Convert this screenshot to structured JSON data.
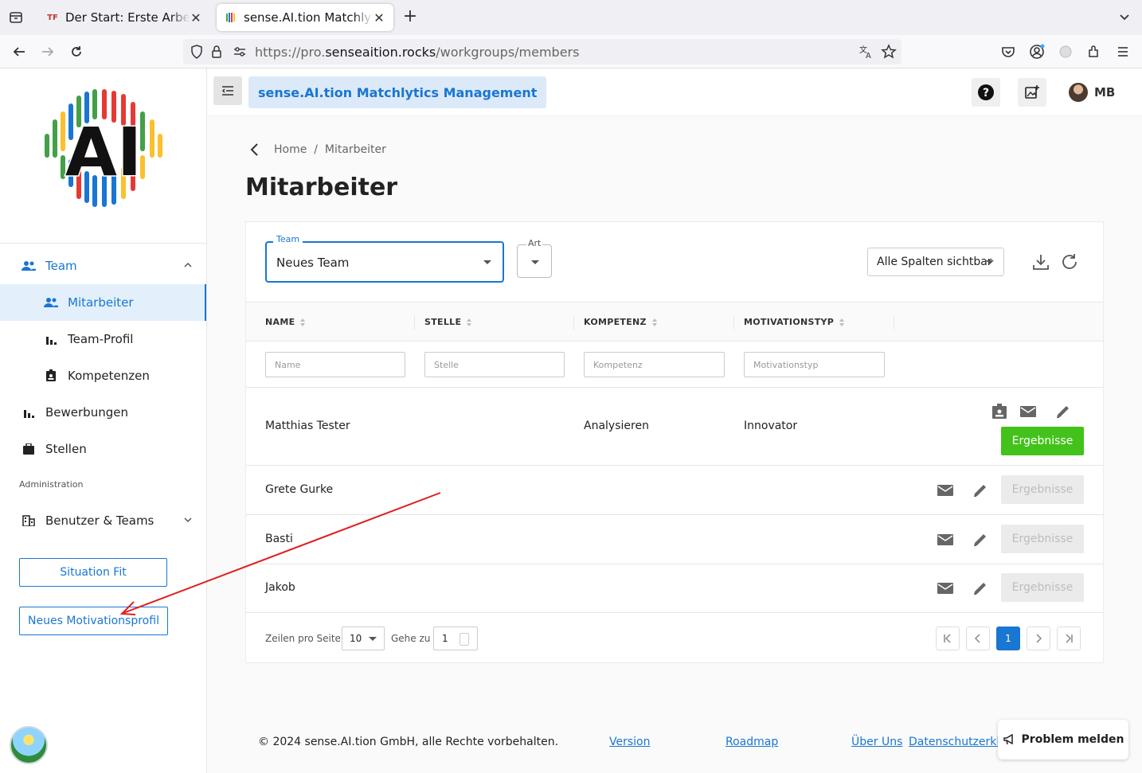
{
  "browser": {
    "tabs": [
      {
        "title": "Der Start: Erste Arbeit",
        "favicon": "TF"
      },
      {
        "title": "sense.AI.tion Matchlyt",
        "favicon": "AI"
      }
    ],
    "url_prefix": "https://pro.",
    "url_domain": "senseaition.rocks",
    "url_path": "/workgroups/members"
  },
  "sidebar": {
    "team_label": "Team",
    "items": [
      {
        "label": "Mitarbeiter"
      },
      {
        "label": "Team-Profil"
      },
      {
        "label": "Kompetenzen"
      },
      {
        "label": "Bewerbungen"
      },
      {
        "label": "Stellen"
      }
    ],
    "section_label": "Administration",
    "admin_item": "Benutzer & Teams",
    "buttons": {
      "situation_fit": "Situation Fit",
      "new_profile": "Neues Motivationsprofil"
    }
  },
  "appbar": {
    "title": "sense.AI.tion Matchlytics Management",
    "user_initials": "MB"
  },
  "page": {
    "breadcrumb": "Home  /  Mitarbeiter",
    "title": "Mitarbeiter"
  },
  "filters": {
    "team_label": "Team",
    "team_value": "Neues Team",
    "art_label": "Art",
    "columns_value": "Alle Spalten sichtbar"
  },
  "table": {
    "headers": [
      "NAME",
      "STELLE",
      "KOMPETENZ",
      "MOTIVATIONSTYP"
    ],
    "placeholders": [
      "Name",
      "Stelle",
      "Kompetenz",
      "Motivationstyp"
    ],
    "results_label": "Ergebnisse",
    "rows": [
      {
        "name": "Matthias Tester",
        "stelle": "",
        "kompetenz": "Analysieren",
        "motivationstyp": "Innovator",
        "results_enabled": true
      },
      {
        "name": "Grete Gurke",
        "stelle": "",
        "kompetenz": "",
        "motivationstyp": "",
        "results_enabled": false
      },
      {
        "name": "Basti",
        "stelle": "",
        "kompetenz": "",
        "motivationstyp": "",
        "results_enabled": false
      },
      {
        "name": "Jakob",
        "stelle": "",
        "kompetenz": "",
        "motivationstyp": "",
        "results_enabled": false
      }
    ]
  },
  "pagination": {
    "rows_per_page_label": "Zeilen pro Seite",
    "rows_per_page": "10",
    "goto_label": "Gehe zu",
    "goto_value": "1",
    "current_page": "1"
  },
  "footer": {
    "copyright": "© 2024 sense.AI.tion GmbH, alle Rechte vorbehalten.",
    "links": [
      "Version",
      "Roadmap",
      "Über Uns",
      "Datenschutzerklä"
    ],
    "problem_button": "Problem melden"
  },
  "colors": {
    "accent": "#1976d2",
    "success": "#43c21b",
    "annotation": "#e0201e"
  }
}
